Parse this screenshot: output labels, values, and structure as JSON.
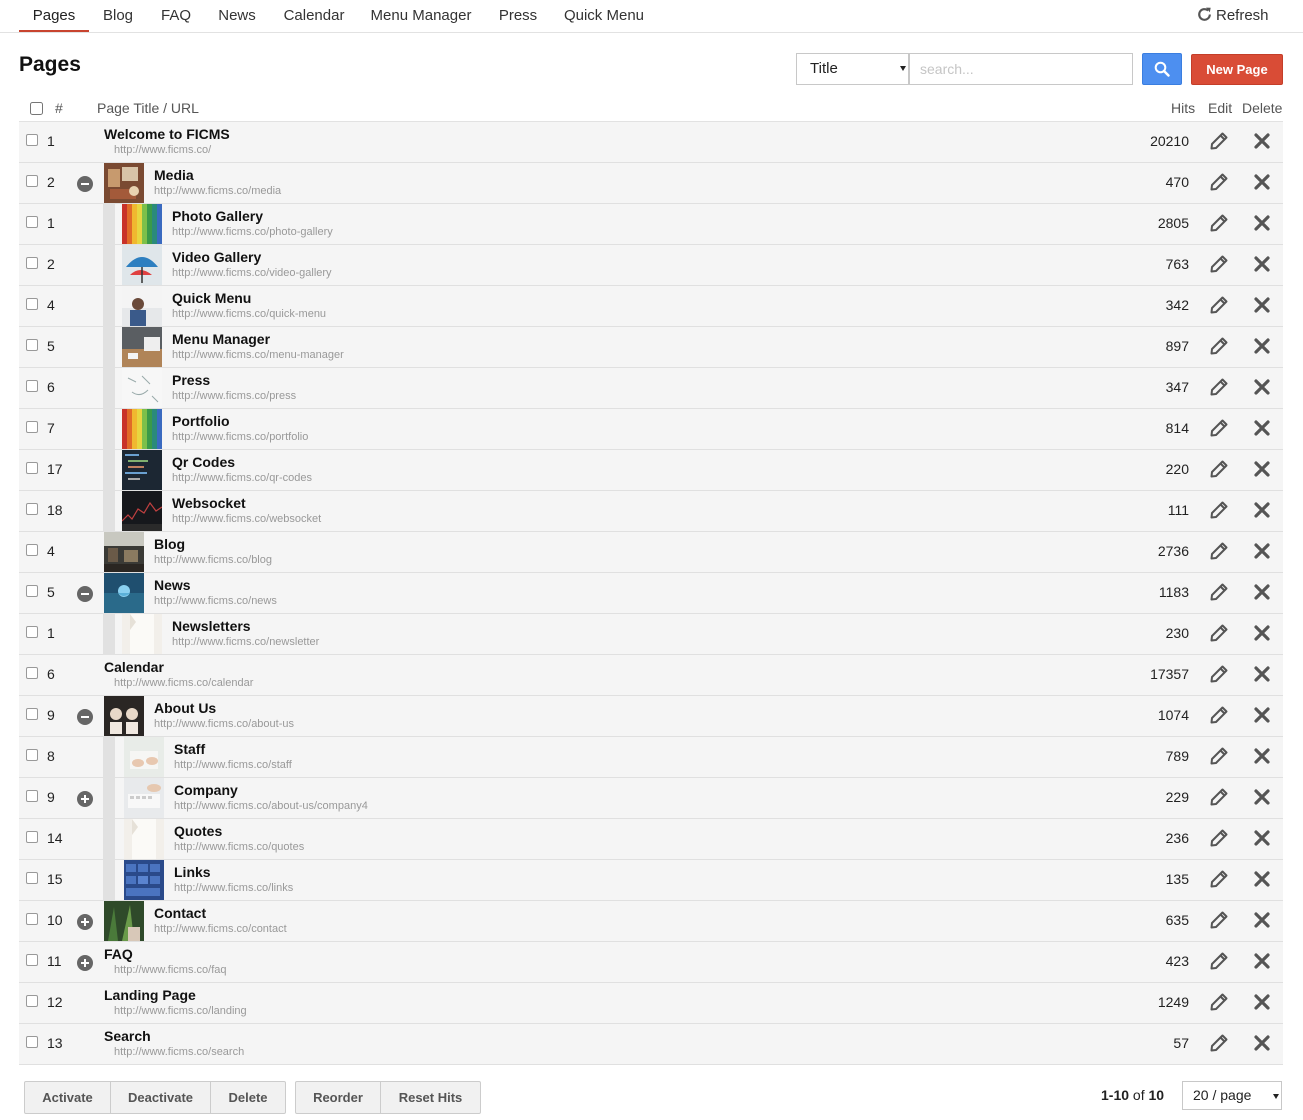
{
  "nav": {
    "tabs": [
      "Pages",
      "Blog",
      "FAQ",
      "News",
      "Calendar",
      "Menu Manager",
      "Press",
      "Quick Menu"
    ],
    "refresh_label": "Refresh"
  },
  "page_title": "Pages",
  "search": {
    "field_selected": "Title",
    "placeholder": "search...",
    "value": ""
  },
  "new_page_label": "New Page",
  "columns": {
    "num": "#",
    "title": "Page Title / URL",
    "hits": "Hits",
    "edit": "Edit",
    "delete": "Delete"
  },
  "rows": [
    {
      "num": "1",
      "level": 0,
      "toggle": "",
      "thumb": "",
      "title": "Welcome to FICMS",
      "url": "http://www.ficms.co/",
      "hits": "20210"
    },
    {
      "num": "2",
      "level": 0,
      "toggle": "minus",
      "thumb": "desk",
      "title": "Media",
      "url": "http://www.ficms.co/media",
      "hits": "470"
    },
    {
      "num": "1",
      "level": 1,
      "toggle": "",
      "thumb": "pencils",
      "title": "Photo Gallery",
      "url": "http://www.ficms.co/photo-gallery",
      "hits": "2805"
    },
    {
      "num": "2",
      "level": 1,
      "toggle": "",
      "thumb": "umbrella",
      "title": "Video Gallery",
      "url": "http://www.ficms.co/video-gallery",
      "hits": "763"
    },
    {
      "num": "4",
      "level": 1,
      "toggle": "",
      "thumb": "whiteboard",
      "title": "Quick Menu",
      "url": "http://www.ficms.co/quick-menu",
      "hits": "342"
    },
    {
      "num": "5",
      "level": 1,
      "toggle": "",
      "thumb": "laptop",
      "title": "Menu Manager",
      "url": "http://www.ficms.co/menu-manager",
      "hits": "897"
    },
    {
      "num": "6",
      "level": 1,
      "toggle": "",
      "thumb": "sketch",
      "title": "Press",
      "url": "http://www.ficms.co/press",
      "hits": "347"
    },
    {
      "num": "7",
      "level": 1,
      "toggle": "",
      "thumb": "pencils",
      "title": "Portfolio",
      "url": "http://www.ficms.co/portfolio",
      "hits": "814"
    },
    {
      "num": "17",
      "level": 1,
      "toggle": "",
      "thumb": "code",
      "title": "Qr Codes",
      "url": "http://www.ficms.co/qr-codes",
      "hits": "220"
    },
    {
      "num": "18",
      "level": 1,
      "toggle": "",
      "thumb": "chart",
      "title": "Websocket",
      "url": "http://www.ficms.co/websocket",
      "hits": "111"
    },
    {
      "num": "4",
      "level": 0,
      "toggle": "",
      "thumb": "cafe",
      "title": "Blog",
      "url": "http://www.ficms.co/blog",
      "hits": "2736"
    },
    {
      "num": "5",
      "level": 0,
      "toggle": "minus",
      "thumb": "ocean",
      "title": "News",
      "url": "http://www.ficms.co/news",
      "hits": "1183"
    },
    {
      "num": "1",
      "level": 1,
      "toggle": "",
      "thumb": "paper",
      "title": "Newsletters",
      "url": "http://www.ficms.co/newsletter",
      "hits": "230"
    },
    {
      "num": "6",
      "level": 0,
      "toggle": "",
      "thumb": "",
      "title": "Calendar",
      "url": "http://www.ficms.co/calendar",
      "hits": "17357"
    },
    {
      "num": "9",
      "level": 0,
      "toggle": "minus",
      "thumb": "team",
      "title": "About Us",
      "url": "http://www.ficms.co/about-us",
      "hits": "1074"
    },
    {
      "num": "8",
      "level": 2,
      "toggle": "",
      "thumb": "hands",
      "title": "Staff",
      "url": "http://www.ficms.co/staff",
      "hits": "789"
    },
    {
      "num": "9",
      "level": 2,
      "toggle": "plus",
      "thumb": "keyboard",
      "title": "Company",
      "url": "http://www.ficms.co/about-us/company4",
      "hits": "229"
    },
    {
      "num": "14",
      "level": 2,
      "toggle": "",
      "thumb": "paper",
      "title": "Quotes",
      "url": "http://www.ficms.co/quotes",
      "hits": "236"
    },
    {
      "num": "15",
      "level": 2,
      "toggle": "",
      "thumb": "keys",
      "title": "Links",
      "url": "http://www.ficms.co/links",
      "hits": "135"
    },
    {
      "num": "10",
      "level": 0,
      "toggle": "plus",
      "thumb": "plant",
      "title": "Contact",
      "url": "http://www.ficms.co/contact",
      "hits": "635"
    },
    {
      "num": "11",
      "level": 0,
      "toggle": "plus",
      "thumb": "",
      "title": "FAQ",
      "url": "http://www.ficms.co/faq",
      "hits": "423"
    },
    {
      "num": "12",
      "level": 0,
      "toggle": "",
      "thumb": "",
      "title": "Landing Page",
      "url": "http://www.ficms.co/landing",
      "hits": "1249"
    },
    {
      "num": "13",
      "level": 0,
      "toggle": "",
      "thumb": "",
      "title": "Search",
      "url": "http://www.ficms.co/search",
      "hits": "57"
    }
  ],
  "bulk_actions": [
    "Activate",
    "Deactivate",
    "Delete"
  ],
  "order_actions": [
    "Reorder",
    "Reset Hits"
  ],
  "pagination": {
    "range": "1-10",
    "of_word": "of",
    "total": "10",
    "per_page": "20 / page"
  },
  "colors": {
    "accent": "#c8442f",
    "primary_button": "#d94c36",
    "search_button": "#4d8ff0"
  }
}
